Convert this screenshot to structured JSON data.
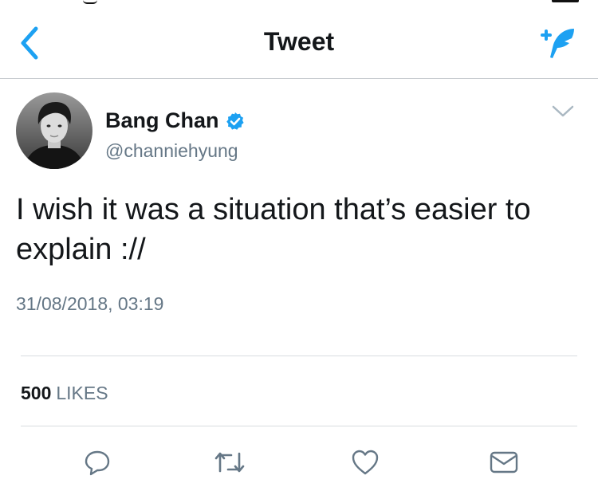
{
  "nav": {
    "title": "Tweet",
    "back_icon": "chevron-left-icon",
    "compose_icon": "compose-feather-icon",
    "accent_color": "#1da1f2"
  },
  "tweet": {
    "author": {
      "name": "Bang Chan",
      "handle": "@channiehyung",
      "verified": true,
      "avatar_icon": "avatar"
    },
    "text": "I wish it was a situation that’s easier to explain ://",
    "timestamp": "31/08/2018, 03:19",
    "stats": {
      "likes_count": "500",
      "likes_label": "LIKES"
    },
    "actions": [
      {
        "name": "reply",
        "icon": "speech-bubble-icon"
      },
      {
        "name": "retweet",
        "icon": "retweet-icon"
      },
      {
        "name": "like",
        "icon": "heart-icon"
      },
      {
        "name": "dm",
        "icon": "envelope-icon"
      }
    ]
  },
  "colors": {
    "text_primary": "#14171a",
    "text_secondary": "#657786",
    "divider": "#d8dce0",
    "verified_blue": "#1da1f2"
  }
}
